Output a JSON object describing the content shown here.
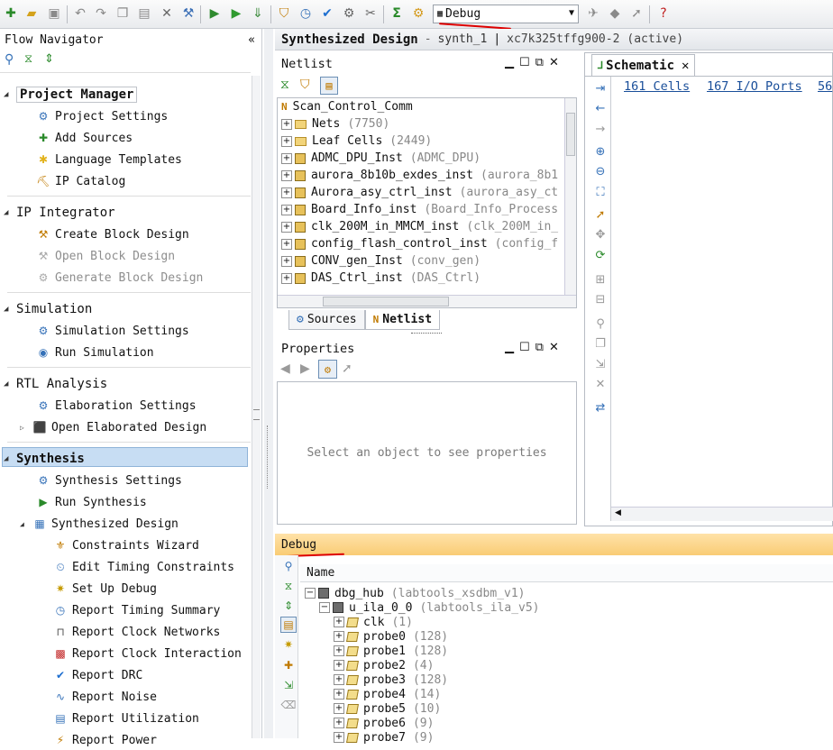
{
  "toolbar": {
    "layout_select": "Debug",
    "layout_icon": "layout-icon"
  },
  "flow_navigator": {
    "title": "Flow Navigator",
    "collapse_icon": "«",
    "sections": [
      {
        "name": "Project Manager",
        "items": [
          "Project Settings",
          "Add Sources",
          "Language Templates",
          "IP Catalog"
        ]
      },
      {
        "name": "IP Integrator",
        "items": [
          "Create Block Design",
          "Open Block Design",
          "Generate Block Design"
        ]
      },
      {
        "name": "Simulation",
        "items": [
          "Simulation Settings",
          "Run Simulation"
        ]
      },
      {
        "name": "RTL Analysis",
        "items": [
          "Elaboration Settings",
          "Open Elaborated Design"
        ]
      },
      {
        "name": "Synthesis",
        "items": [
          "Synthesis Settings",
          "Run Synthesis",
          "Synthesized Design"
        ]
      }
    ],
    "synth_design_items": [
      "Constraints Wizard",
      "Edit Timing Constraints",
      "Set Up Debug",
      "Report Timing Summary",
      "Report Clock Networks",
      "Report Clock Interaction",
      "Report DRC",
      "Report Noise",
      "Report Utilization",
      "Report Power"
    ]
  },
  "design_header": {
    "title": "Synthesized Design",
    "dash": "-",
    "run": "synth_1",
    "bar": "|",
    "part": "xc7k325tffg900-2",
    "status": "(active)"
  },
  "netlist": {
    "title": "Netlist",
    "root": "Scan_Control_Comm",
    "rows": [
      {
        "name": "Nets",
        "detail": "(7750)",
        "kind": "folder"
      },
      {
        "name": "Leaf Cells",
        "detail": "(2449)",
        "kind": "folder"
      },
      {
        "name": "ADMC_DPU_Inst",
        "detail": "(ADMC_DPU)",
        "kind": "cell"
      },
      {
        "name": "aurora_8b10b_exdes_inst",
        "detail": "(aurora_8b1",
        "kind": "cell"
      },
      {
        "name": "Aurora_asy_ctrl_inst",
        "detail": "(aurora_asy_ct",
        "kind": "cell"
      },
      {
        "name": "Board_Info_inst",
        "detail": "(Board_Info_Process",
        "kind": "cell"
      },
      {
        "name": "clk_200M_in_MMCM_inst",
        "detail": "(clk_200M_in_",
        "kind": "cell"
      },
      {
        "name": "config_flash_control_inst",
        "detail": "(config_f",
        "kind": "cell"
      },
      {
        "name": "CONV_gen_Inst",
        "detail": "(conv_gen)",
        "kind": "cell"
      },
      {
        "name": "DAS_Ctrl_inst",
        "detail": "(DAS_Ctrl)",
        "kind": "cell"
      }
    ],
    "tabs": [
      "Sources",
      "Netlist"
    ]
  },
  "properties": {
    "title": "Properties",
    "placeholder": "Select an object to see properties"
  },
  "schematic": {
    "tab": "Schematic",
    "cells_link": "161 Cells",
    "ports_link": "167 I/O Ports",
    "nets_link": "56"
  },
  "debug": {
    "title": "Debug",
    "column": "Name",
    "rows": [
      {
        "name": "dbg_hub",
        "detail": "(labtools_xsdbm_v1)",
        "level": 0,
        "kind": "core"
      },
      {
        "name": "u_ila_0_0",
        "detail": "(labtools_ila_v5)",
        "level": 1,
        "kind": "core"
      },
      {
        "name": "clk",
        "detail": "(1)",
        "level": 2,
        "kind": "probe"
      },
      {
        "name": "probe0",
        "detail": "(128)",
        "level": 2,
        "kind": "probe"
      },
      {
        "name": "probe1",
        "detail": "(128)",
        "level": 2,
        "kind": "probe"
      },
      {
        "name": "probe2",
        "detail": "(4)",
        "level": 2,
        "kind": "probe"
      },
      {
        "name": "probe3",
        "detail": "(128)",
        "level": 2,
        "kind": "probe"
      },
      {
        "name": "probe4",
        "detail": "(14)",
        "level": 2,
        "kind": "probe"
      },
      {
        "name": "probe5",
        "detail": "(10)",
        "level": 2,
        "kind": "probe"
      },
      {
        "name": "probe6",
        "detail": "(9)",
        "level": 2,
        "kind": "probe"
      },
      {
        "name": "probe7",
        "detail": "(9)",
        "level": 2,
        "kind": "probe"
      }
    ]
  },
  "colors": {
    "accent_blue": "#1a4f9a",
    "debug_orange": "#f9cc75",
    "annotation_red": "#dd0000"
  }
}
